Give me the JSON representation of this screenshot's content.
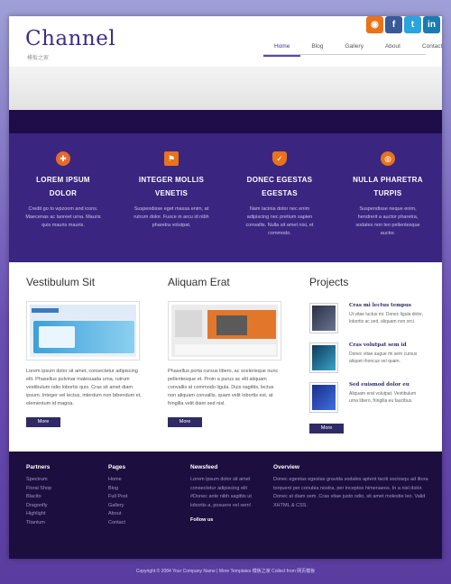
{
  "header": {
    "logo": "Channel",
    "logo_sub": "模板之家",
    "nav": [
      "Home",
      "Blog",
      "Gallery",
      "About",
      "Contact"
    ],
    "social": [
      "rss-icon",
      "facebook-icon",
      "twitter-icon",
      "linkedin-icon"
    ]
  },
  "features": [
    {
      "title_1": "LOREM IPSUM",
      "title_2": "DOLOR",
      "icon": "lifebuoy-icon",
      "color": "#e86a2a",
      "text": "Credit go to wpzoom and icons. Maecenas ac laoreet urna. Mauris quis mauris mauris."
    },
    {
      "title_1": "INTEGER MOLLIS",
      "title_2": "VENETIS",
      "icon": "flag-icon",
      "color": "#e8731b",
      "text": "Suspendisse eget massa enim, at rutrum dolor. Fusce in arcu id nibh pharetra volutpat."
    },
    {
      "title_1": "DONEC EGESTAS",
      "title_2": "EGESTAS",
      "icon": "shield-icon",
      "color": "#e8731b",
      "text": "Nam lacinia dolor nec enim adipiscing nec pretium sapien convallis. Nulla sit amet nisi, et commodo."
    },
    {
      "title_1": "NULLA PHARETRA",
      "title_2": "TURPIS",
      "icon": "globe-icon",
      "color": "#e8731b",
      "text": "Suspendisse neque enim, hendrerit a auctor pharetra, sodales non leo pellentesque auctor."
    }
  ],
  "content": {
    "col1": {
      "title": "Vestibulum Sit",
      "text": "Lorem ipsum dolor sit amet, consectetur adipiscing elit. Phasellus pulvinar malesuada urna, rutrum vestibulum odio lobortis quis. Cras sit amet diam ipsum. Integer vel lectus, interdum non bibendum et, elementum id magna.",
      "more": "More"
    },
    "col2": {
      "title": "Aliquam Erat",
      "text": "Phasellus porta cursus libero, ac scelerisque nunc pellentesque et. Proin a purus ac elit aliquam convallis at commodo ligula. Duis sagittis, lectus non aliquam convallis, quam velit lobortis est, at fringilla velit diam sed nisl.",
      "more": "More"
    },
    "col3": {
      "title": "Projects",
      "items": [
        {
          "title": "Cras mi lectus tempus",
          "desc": "Ut vitae luctus mi. Donec ligula dolor, lobortis ac sed, aliquam non orci."
        },
        {
          "title": "Cras volutpat sem id",
          "desc": "Donec vitae augue mi sem cursus aliquet rhoncus vel quam."
        },
        {
          "title": "Sed euismod dolor eu",
          "desc": "Aliquam erat volutpat. Vestibulum urna libero, fringilla eu faucibus."
        }
      ],
      "more": "More"
    }
  },
  "footer": {
    "partners": {
      "title": "Partners",
      "items": [
        "Spectrum",
        "Floral Shop",
        "Blacito",
        "Dragonfly",
        "Highlight",
        "Titanium"
      ]
    },
    "pages": {
      "title": "Pages",
      "items": [
        "Home",
        "Blog",
        "Full Post",
        "Gallery",
        "About",
        "Contact"
      ]
    },
    "newsfeed": {
      "title": "Newsfeed",
      "text": "Lorem ipsum dolor sit amet consectetur adipiscing elit #Donec ante nibh sagittis ut lobortis a, posuere vel sem!",
      "sub": "Follow us"
    },
    "overview": {
      "title": "Overview",
      "text": "Donec egestas egestas gravida sodales aptent taciti sociosqu ad litora torquent per conubia nostra, per inceptos himenaeos. In a nisl dolor. Donec at diam sem. Cras vitae justo odio, sit amet molestie leo. Valid XHTML & CSS."
    }
  },
  "copyright": "Copyright © 2084 Your Company Name | More Templates 模板之家 Collect from 网页模板"
}
